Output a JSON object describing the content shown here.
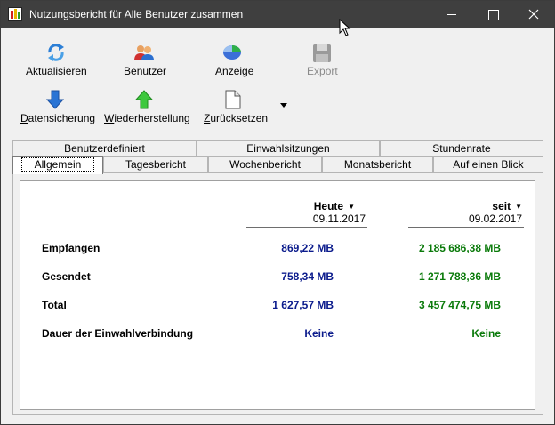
{
  "window": {
    "title": "Nutzungsbericht für Alle Benutzer zusammen"
  },
  "toolbar": {
    "row1": [
      {
        "label": "Aktualisieren",
        "icon": "refresh-icon"
      },
      {
        "label": "Benutzer",
        "icon": "users-icon"
      },
      {
        "label": "Anzeige",
        "icon": "display-icon"
      },
      {
        "label": "Export",
        "icon": "save-icon",
        "disabled": true
      }
    ],
    "row2": [
      {
        "label": "Datensicherung",
        "icon": "arrow-down-icon"
      },
      {
        "label": "Wiederherstellung",
        "icon": "arrow-up-icon"
      },
      {
        "label": "Zurücksetzen",
        "icon": "document-icon"
      }
    ]
  },
  "tabs": {
    "row_top": [
      "Benutzerdefiniert",
      "Einwahlsitzungen",
      "Stundenrate"
    ],
    "row_bottom": [
      "Allgemein",
      "Tagesbericht",
      "Wochenbericht",
      "Monatsbericht",
      "Auf einen Blick"
    ],
    "active": "Allgemein"
  },
  "report": {
    "col1": {
      "header": "Heute",
      "date": "09.11.2017"
    },
    "col2": {
      "header": "seit",
      "date": "09.02.2017"
    },
    "rows": [
      {
        "label": "Empfangen",
        "v1": "869,22 MB",
        "v2": "2 185 686,38 MB"
      },
      {
        "label": "Gesendet",
        "v1": "758,34 MB",
        "v2": "1 271 788,36 MB"
      },
      {
        "label": "Total",
        "v1": "1 627,57 MB",
        "v2": "3 457 474,75 MB"
      },
      {
        "label": "Dauer der Einwahlverbindung",
        "v1": "Keine",
        "v2": "Keine"
      }
    ]
  },
  "colors": {
    "titlebar": "#3f3f3f",
    "value_blue": "#0b1b8c",
    "value_green": "#0a7a0a"
  }
}
